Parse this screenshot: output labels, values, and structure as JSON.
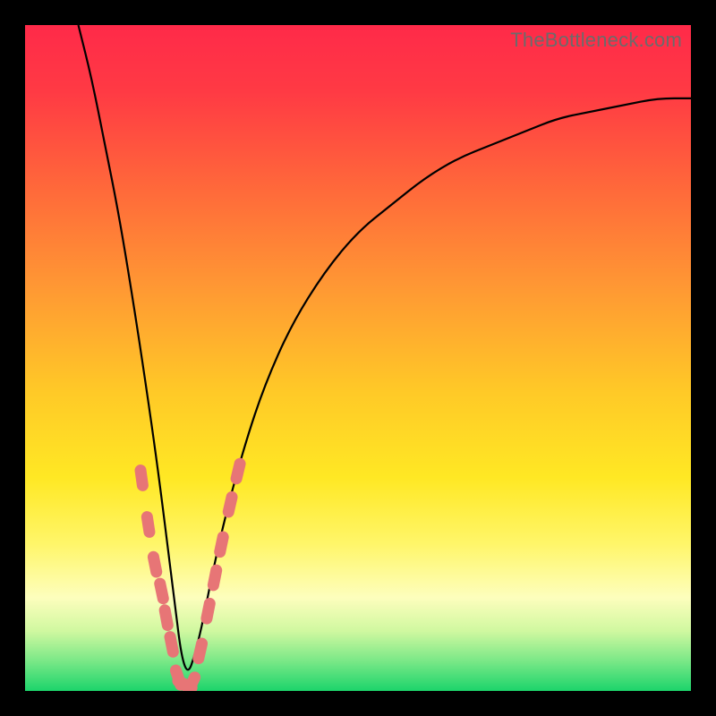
{
  "watermark": "TheBottleneck.com",
  "colors": {
    "background": "#000000",
    "marker": "#e77576",
    "curve": "#000000",
    "gradient_stops": [
      {
        "offset": 0.0,
        "color": "#ff2a49"
      },
      {
        "offset": 0.1,
        "color": "#ff3a44"
      },
      {
        "offset": 0.25,
        "color": "#ff6a3a"
      },
      {
        "offset": 0.4,
        "color": "#ff9a33"
      },
      {
        "offset": 0.55,
        "color": "#ffc927"
      },
      {
        "offset": 0.68,
        "color": "#ffe824"
      },
      {
        "offset": 0.78,
        "color": "#fff66a"
      },
      {
        "offset": 0.86,
        "color": "#fdfebd"
      },
      {
        "offset": 0.91,
        "color": "#d0f8a0"
      },
      {
        "offset": 0.955,
        "color": "#7ae887"
      },
      {
        "offset": 1.0,
        "color": "#1cd46b"
      }
    ]
  },
  "chart_data": {
    "type": "line",
    "title": "",
    "xlabel": "",
    "ylabel": "",
    "x_range": [
      0,
      100
    ],
    "y_range": [
      0,
      100
    ],
    "legend": false,
    "grid": false,
    "series": [
      {
        "name": "bottleneck-curve",
        "note": "V-shaped curve; minimum ≈0 at x≈24; left branch near-vertical, right branch rises asymptotically",
        "x": [
          8,
          10,
          12,
          14,
          16,
          18,
          20,
          22,
          24,
          26,
          28,
          30,
          33,
          36,
          40,
          45,
          50,
          55,
          60,
          65,
          70,
          75,
          80,
          85,
          90,
          95,
          100
        ],
        "y": [
          100,
          92,
          82,
          72,
          60,
          47,
          33,
          17,
          1,
          7,
          17,
          26,
          37,
          46,
          55,
          63,
          69,
          73,
          77,
          80,
          82,
          84,
          86,
          87,
          88,
          89,
          89
        ]
      }
    ],
    "markers": {
      "name": "highlighted-band",
      "note": "Pink capsule markers near the trough of the curve",
      "shape": "capsule",
      "points": [
        {
          "x": 17.5,
          "y": 32
        },
        {
          "x": 18.5,
          "y": 25
        },
        {
          "x": 19.5,
          "y": 19
        },
        {
          "x": 20.5,
          "y": 15
        },
        {
          "x": 21.2,
          "y": 11
        },
        {
          "x": 22.0,
          "y": 7
        },
        {
          "x": 23.0,
          "y": 2
        },
        {
          "x": 24.0,
          "y": 1
        },
        {
          "x": 25.0,
          "y": 1
        },
        {
          "x": 26.3,
          "y": 6
        },
        {
          "x": 27.5,
          "y": 12
        },
        {
          "x": 28.5,
          "y": 17
        },
        {
          "x": 29.5,
          "y": 22
        },
        {
          "x": 30.8,
          "y": 28
        },
        {
          "x": 32.0,
          "y": 33
        }
      ]
    }
  }
}
